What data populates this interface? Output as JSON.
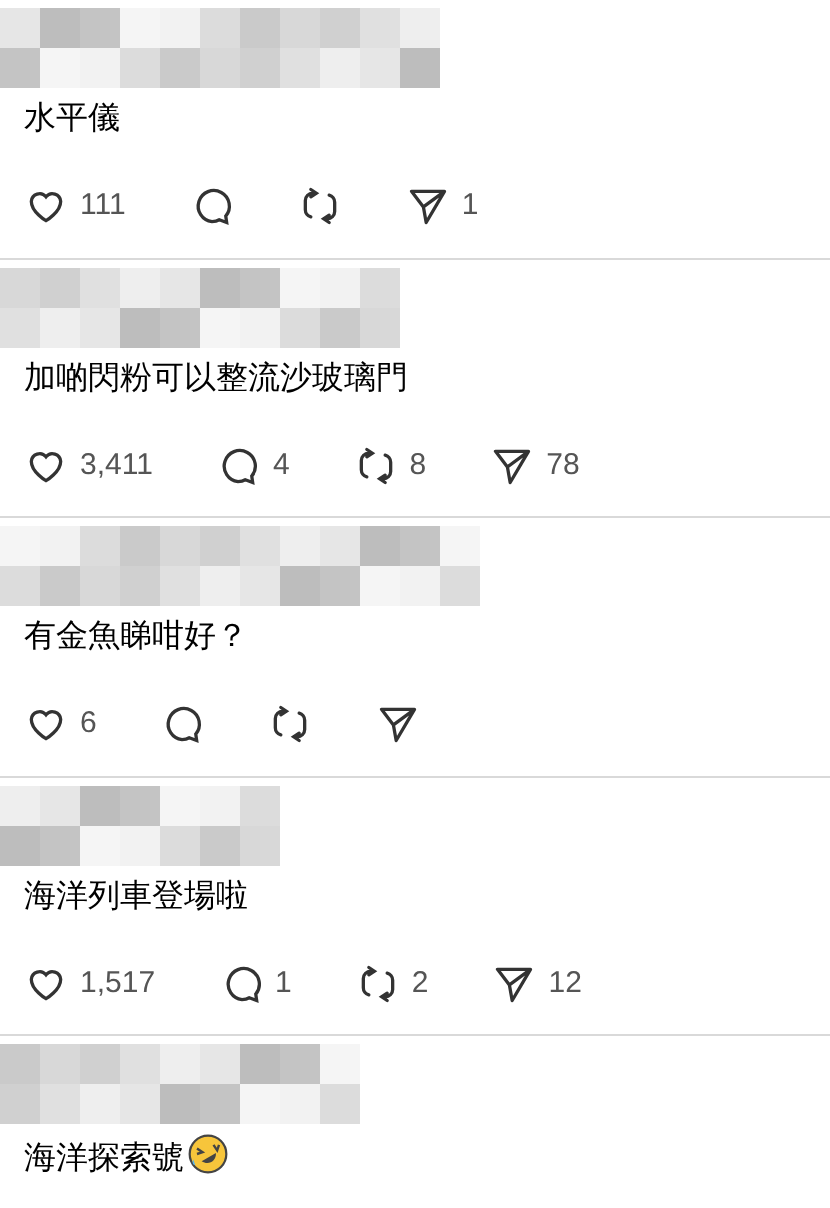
{
  "comments": [
    {
      "text": "水平儀",
      "likes": "111",
      "shares": "1"
    },
    {
      "text": "加啲閃粉可以整流沙玻璃門",
      "likes": "3,411",
      "replies": "4",
      "reposts": "8",
      "shares": "78"
    },
    {
      "text": "有金魚睇咁好？",
      "likes": "6"
    },
    {
      "text": "海洋列車登場啦",
      "likes": "1,517",
      "replies": "1",
      "reposts": "2",
      "shares": "12"
    },
    {
      "text": "海洋探索號",
      "trailing_emoji": true
    }
  ]
}
